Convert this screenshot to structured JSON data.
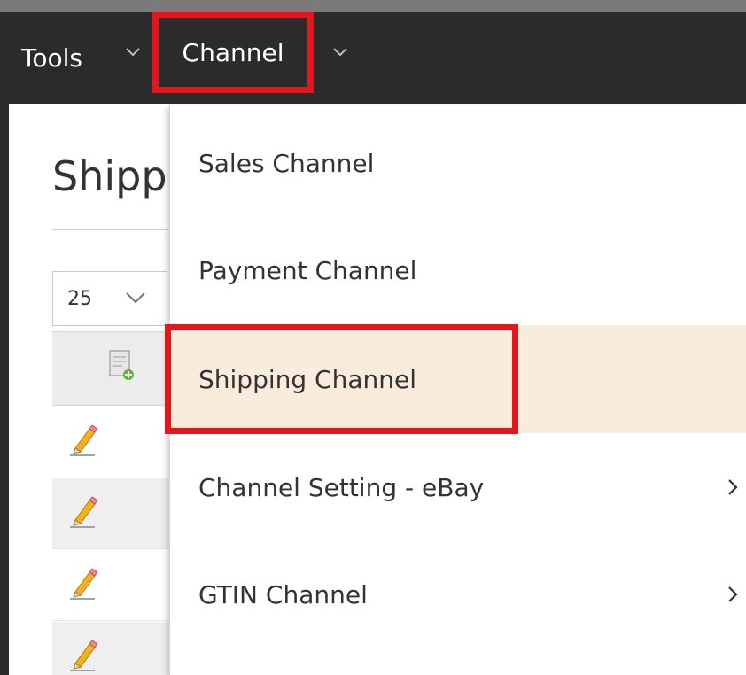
{
  "navbar": {
    "tools_label": "Tools",
    "channel_label": "Channel"
  },
  "page": {
    "title": "Shipp",
    "pager_value": "25",
    "row_count": 4
  },
  "dropdown": {
    "items": [
      {
        "label": "Sales Channel",
        "has_submenu": false
      },
      {
        "label": "Payment Channel",
        "has_submenu": false
      },
      {
        "label": "Shipping Channel",
        "has_submenu": false,
        "highlighted": true
      },
      {
        "label": "Channel Setting - eBay",
        "has_submenu": true
      },
      {
        "label": "GTIN Channel",
        "has_submenu": true
      }
    ]
  },
  "colors": {
    "navbar_bg": "#2b2b2b",
    "highlight_bg": "#faecdd",
    "annotation_red": "#e4161d"
  }
}
